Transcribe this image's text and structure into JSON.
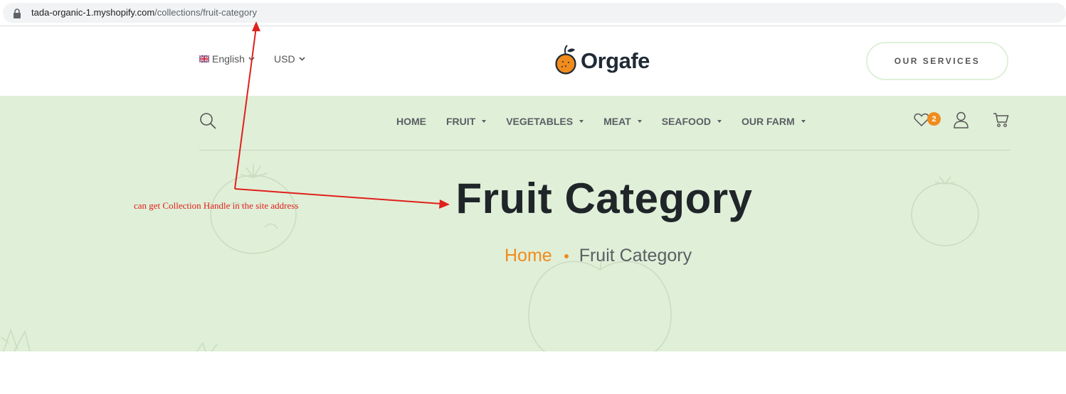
{
  "browser": {
    "url_domain": "tada-organic-1.myshopify.com",
    "url_path": "/collections/fruit-category",
    "lock_icon": "lock-icon"
  },
  "header": {
    "language": "English",
    "currency": "USD",
    "logo_text": "Orgafe",
    "services_button": "OUR SERVICES"
  },
  "nav": {
    "items": [
      {
        "label": "HOME",
        "has_dropdown": false
      },
      {
        "label": "FRUIT",
        "has_dropdown": true
      },
      {
        "label": "VEGETABLES",
        "has_dropdown": true
      },
      {
        "label": "MEAT",
        "has_dropdown": true
      },
      {
        "label": "SEAFOOD",
        "has_dropdown": true
      },
      {
        "label": "OUR FARM",
        "has_dropdown": true
      }
    ],
    "wishlist_count": "2",
    "icons": [
      "search-icon",
      "heart-icon",
      "user-icon",
      "cart-icon"
    ]
  },
  "hero": {
    "title": "Fruit Category",
    "breadcrumb_home": "Home",
    "breadcrumb_current": "Fruit Category"
  },
  "annotation": {
    "text": "can get Collection Handle in the site address",
    "color": "#e0201b"
  },
  "colors": {
    "accent": "#f08b1e",
    "hero_bg": "#e0efd8",
    "text_dark": "#1f2528"
  }
}
